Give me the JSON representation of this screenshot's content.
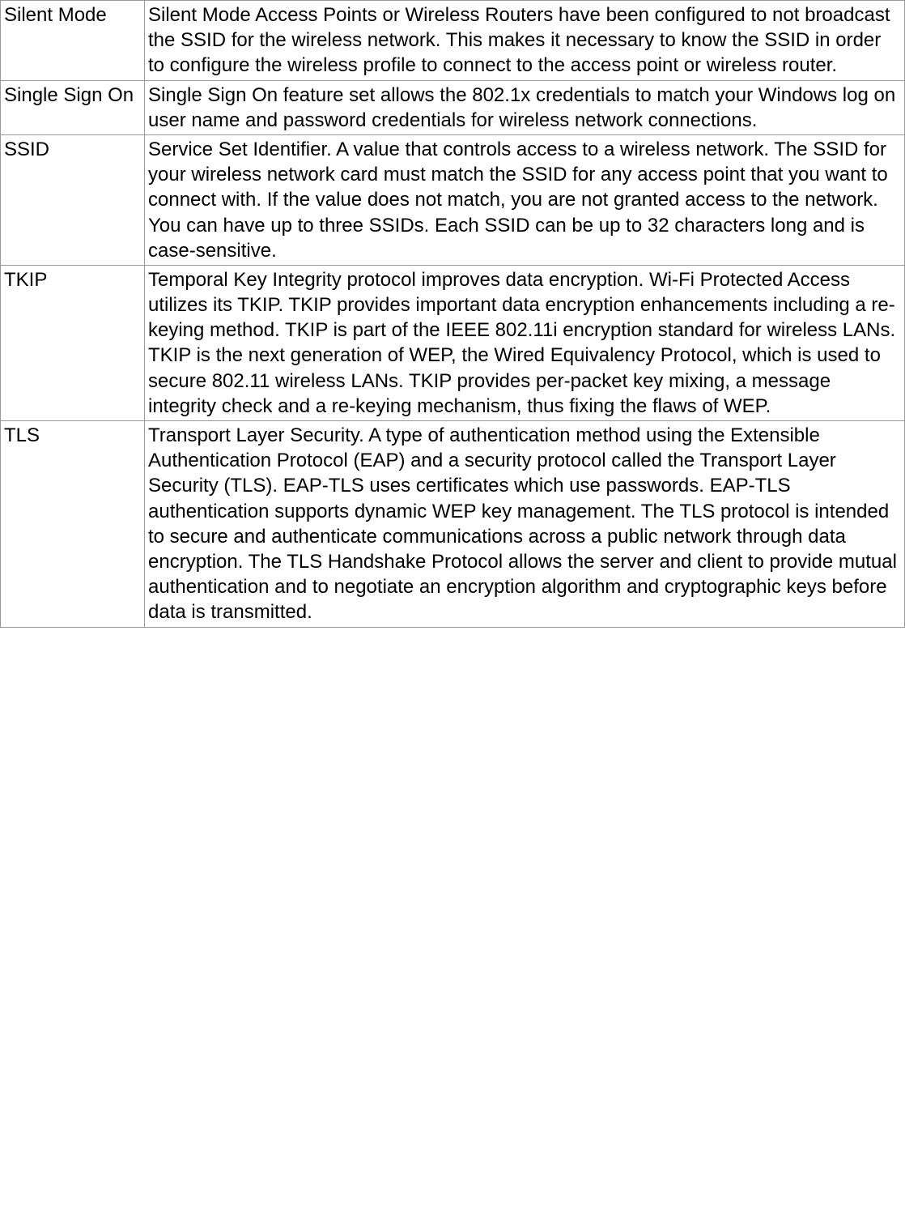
{
  "glossary": {
    "rows": [
      {
        "term": "Silent Mode",
        "definition": "Silent Mode Access Points or Wireless Routers have been configured to not broadcast the SSID for the wireless network.  This makes it necessary to know the SSID in order to configure the wireless profile to connect to the access point or wireless router."
      },
      {
        "term": "Single Sign On",
        "definition": "Single Sign On feature set allows the 802.1x credentials to match your Windows log on user name and password credentials for wireless network connections."
      },
      {
        "term": "SSID",
        "definition": "Service Set Identifier. A value that controls access to a wireless network. The SSID for your wireless network card must match the SSID for any access point that you want to connect with. If the value does not match, you are not granted access to the network. You can have up to three SSIDs. Each SSID can be up to 32 characters long and is case-sensitive."
      },
      {
        "term": "TKIP",
        "definition": "Temporal Key Integrity protocol improves data encryption. Wi-Fi Protected Access utilizes its TKIP. TKIP provides important data encryption enhancements including a re-keying method. TKIP is part of the IEEE 802.11i encryption standard for wireless LANs. TKIP is the next generation of WEP, the Wired Equivalency Protocol, which is used to secure 802.11 wireless LANs. TKIP provides per-packet key mixing, a message integrity check and a re-keying mechanism, thus fixing the flaws of WEP."
      },
      {
        "term": "TLS",
        "definition": "Transport Layer Security. A type of authentication method using the Extensible Authentication Protocol (EAP) and a security protocol called the Transport Layer Security (TLS). EAP-TLS uses certificates which use passwords. EAP-TLS authentication supports dynamic WEP key management. The TLS protocol is intended to secure and authenticate communications across a public network through data encryption. The TLS Handshake Protocol allows the server and client to provide mutual authentication and to negotiate an encryption algorithm and cryptographic keys before data is transmitted."
      }
    ]
  }
}
